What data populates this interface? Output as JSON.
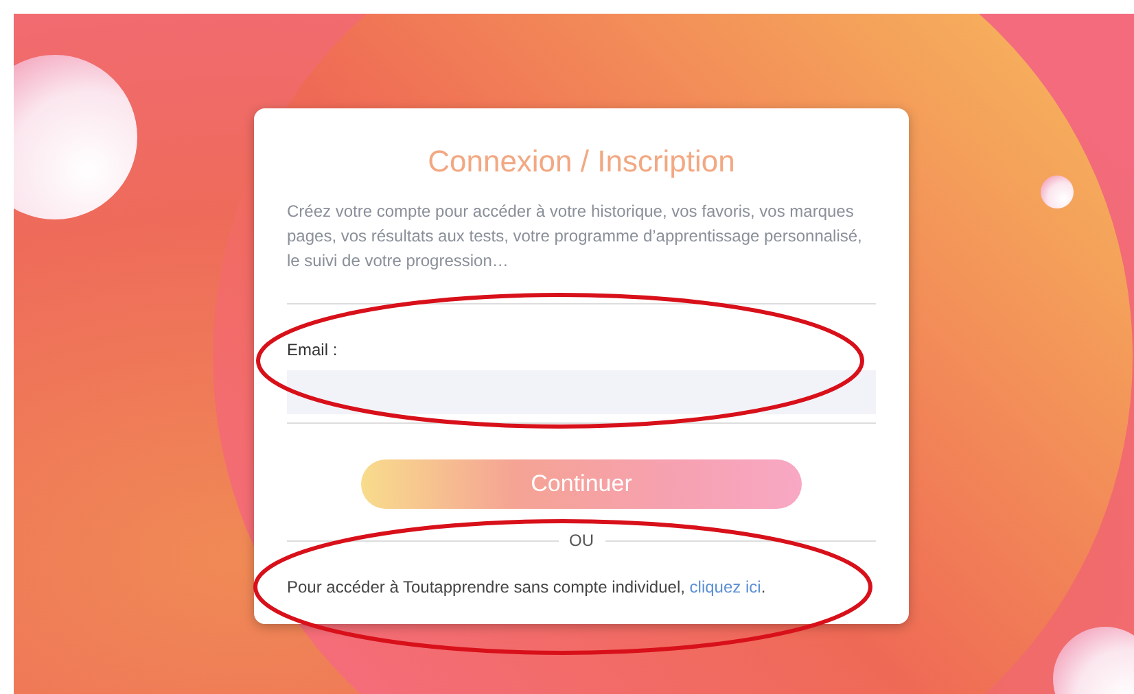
{
  "card": {
    "title": "Connexion / Inscription",
    "intro": "Créez votre compte pour accéder à votre historique, vos favoris, vos marques pages, vos résultats aux tests, votre programme d’apprentissage personnalisé, le suivi de votre progression…",
    "email_label": "Email :",
    "continue_button": "Continuer",
    "separator": "OU",
    "guest_text": {
      "prefix": "Pour accéder à Toutapprendre sans compte individuel, ",
      "link": "cliquez ici",
      "suffix": "."
    }
  }
}
